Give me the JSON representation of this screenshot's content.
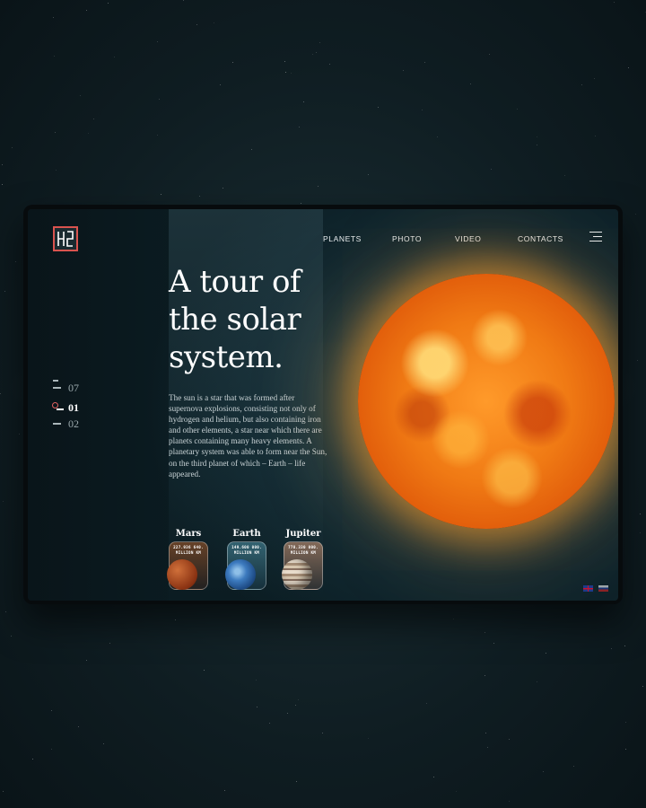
{
  "brand": {
    "logo_text": "HS"
  },
  "nav": {
    "items": [
      "PLANETS",
      "PHOTO",
      "VIDEO",
      "CONTACTS"
    ],
    "menu_icon": "hamburger-menu-icon"
  },
  "hero": {
    "title_lines": [
      "A tour of",
      "the solar",
      "system."
    ],
    "description": "The sun is a star that was formed after supernova explosions, consisting not only of hydrogen and helium, but also containing iron and other elements, a star near which there are planets containing many heavy elements. A planetary system was able to form near the Sun, on the third planet of which – Earth – life appeared."
  },
  "pager": {
    "items": [
      {
        "label": "07",
        "active": false
      },
      {
        "label": "01",
        "active": true
      },
      {
        "label": "02",
        "active": false
      }
    ]
  },
  "planets": [
    {
      "name": "Mars",
      "distance": "227.936 640.",
      "unit": "MILLION KM",
      "color": "#b5501e"
    },
    {
      "name": "Earth",
      "distance": "149.600 000.",
      "unit": "MILLION KM",
      "color": "#2e6fb0"
    },
    {
      "name": "Jupiter",
      "distance": "778.330 000.",
      "unit": "MILLION KM",
      "color": "#c9b8a0"
    }
  ],
  "languages": [
    "en-flag-icon",
    "ru-flag-icon"
  ],
  "colors": {
    "accent": "#d9534f",
    "sun": "#f07a14",
    "background": "#112830"
  }
}
